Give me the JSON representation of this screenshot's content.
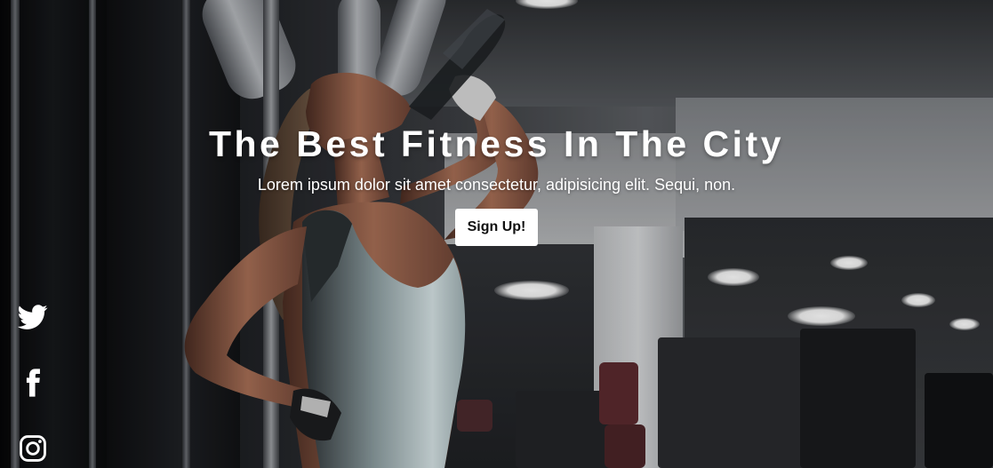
{
  "hero": {
    "title": "The Best Fitness In The City",
    "subtitle": "Lorem ipsum dolor sit amet consectetur, adipisicing elit. Sequi, non.",
    "cta_label": "Sign Up!"
  },
  "social": {
    "icons": [
      "twitter-icon",
      "facebook-icon",
      "instagram-icon"
    ]
  },
  "colors": {
    "text": "#ffffff",
    "button_bg": "#ffffff",
    "button_text": "#111111"
  }
}
